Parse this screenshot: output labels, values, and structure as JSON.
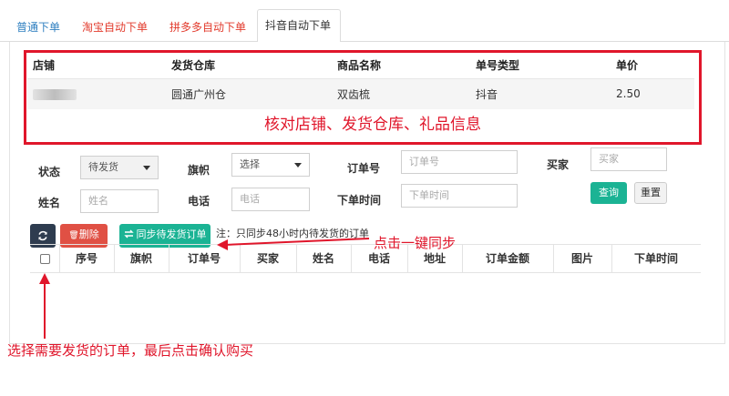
{
  "tabs": [
    {
      "label": "普通下单"
    },
    {
      "label": "淘宝自动下单"
    },
    {
      "label": "拼多多自动下单"
    },
    {
      "label": "抖音自动下单"
    }
  ],
  "info_table": {
    "headers": [
      "店铺",
      "发货仓库",
      "商品名称",
      "单号类型",
      "单价"
    ],
    "row": {
      "warehouse": "圆通广州仓",
      "product": "双齿梳",
      "order_type": "抖音",
      "price": "2.50"
    }
  },
  "callout_info": "核对店铺、发货仓库、礼品信息",
  "form": {
    "status_label": "状态",
    "status_value": "待发货",
    "flag_label": "旗帜",
    "flag_value": "选择",
    "order_no_label": "订单号",
    "order_no_placeholder": "订单号",
    "buyer_label": "买家",
    "buyer_placeholder": "买家",
    "name_label": "姓名",
    "name_placeholder": "姓名",
    "phone_label": "电话",
    "phone_placeholder": "电话",
    "time_label": "下单时间",
    "time_placeholder": "下单时间",
    "query_label": "查询",
    "reset_label": "重置"
  },
  "toolbar": {
    "delete_label": "删除",
    "sync_label": "同步待发货订单",
    "note": "注：只同步48小时内待发货的订单"
  },
  "order_table": {
    "headers": [
      "序号",
      "旗帜",
      "订单号",
      "买家",
      "姓名",
      "电话",
      "地址",
      "订单金额",
      "图片",
      "下单时间"
    ]
  },
  "annotations": {
    "sync": "点击一键同步",
    "bottom": "选择需要发货的订单，最后点击确认购买"
  },
  "colors": {
    "accent": "#1bb394",
    "danger": "#e05044",
    "annotation": "#e0162b",
    "tab_link": "#2f7fc0"
  },
  "icons": [
    "refresh-icon",
    "trash-icon",
    "sync-icon",
    "chevron-down-icon"
  ]
}
